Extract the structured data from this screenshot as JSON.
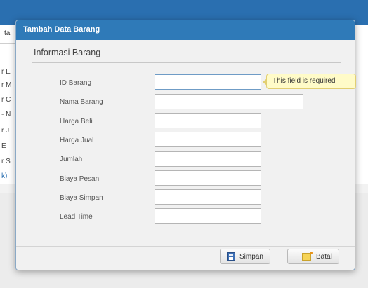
{
  "background": {
    "header_text": "ta",
    "row_fragments": [
      "r E",
      "r M",
      "r C",
      "- N",
      "r J",
      "E",
      "r S",
      "k)"
    ]
  },
  "dialog": {
    "title": "Tambah Data Barang",
    "section_title": "Informasi Barang",
    "fields": [
      {
        "label": "ID Barang",
        "value": "",
        "placeholder": ""
      },
      {
        "label": "Nama Barang",
        "value": "",
        "placeholder": ""
      },
      {
        "label": "Harga Beli",
        "value": "",
        "placeholder": ""
      },
      {
        "label": "Harga Jual",
        "value": "",
        "placeholder": ""
      },
      {
        "label": "Jumlah",
        "value": "",
        "placeholder": ""
      },
      {
        "label": "Biaya Pesan",
        "value": "",
        "placeholder": ""
      },
      {
        "label": "Biaya Simpan",
        "value": "",
        "placeholder": ""
      },
      {
        "label": "Lead Time",
        "value": "",
        "placeholder": ""
      }
    ],
    "validation_tooltip": "This field is required",
    "buttons": {
      "save_label": "Simpan",
      "save_icon": "floppy-disk-icon",
      "cancel_label": "Batal",
      "cancel_icon": "folder-cancel-icon"
    }
  },
  "colors": {
    "titlebar": "#2f7ab8",
    "tooltip_bg": "#fffbc8",
    "focus_border": "#6f9cc6"
  }
}
